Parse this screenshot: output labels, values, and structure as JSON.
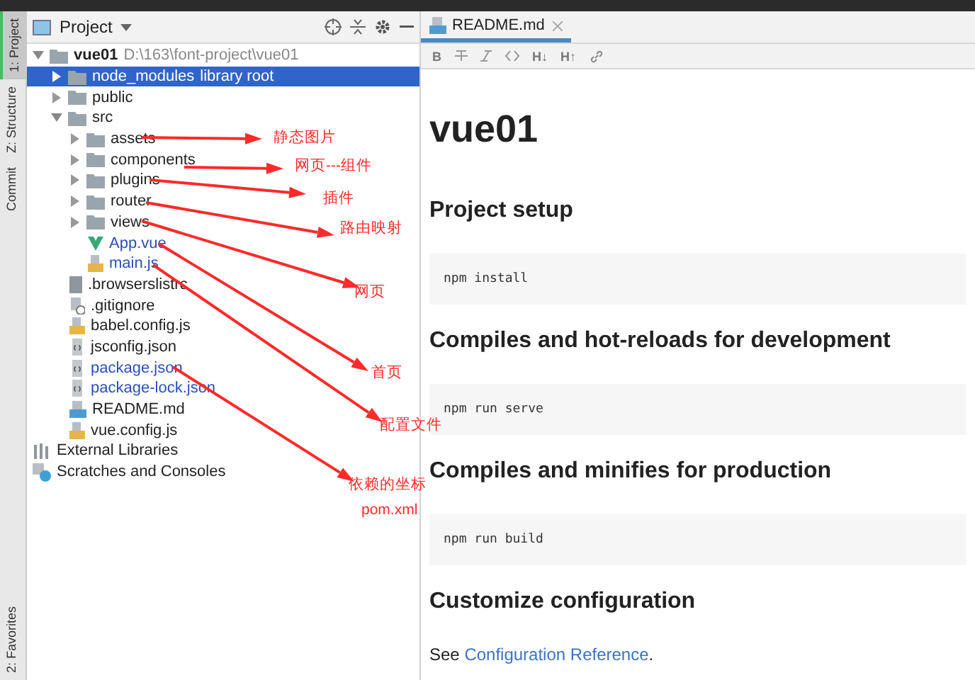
{
  "tool_strip": {
    "top": [
      {
        "label": "1: Project",
        "selected": true
      },
      {
        "label": "Z: Structure",
        "selected": false
      },
      {
        "label": "Commit",
        "selected": false
      }
    ],
    "bottom": [
      {
        "label": "2: Favorites",
        "selected": false
      }
    ]
  },
  "project_panel": {
    "title": "Project",
    "tree": [
      {
        "kind": "folder",
        "name": "vue01",
        "note": "D:\\163\\font-project\\vue01",
        "expanded": true,
        "selected": false,
        "children": [
          {
            "kind": "folder",
            "name": "node_modules",
            "note": "library root",
            "expanded": false,
            "selected": true
          },
          {
            "kind": "folder",
            "name": "public",
            "expanded": false,
            "selected": false
          },
          {
            "kind": "folder",
            "name": "src",
            "expanded": true,
            "selected": false,
            "children": [
              {
                "kind": "folder",
                "name": "assets",
                "expanded": false,
                "selected": false
              },
              {
                "kind": "folder",
                "name": "components",
                "expanded": false,
                "selected": false
              },
              {
                "kind": "folder",
                "name": "plugins",
                "expanded": false,
                "selected": false
              },
              {
                "kind": "folder",
                "name": "router",
                "expanded": false,
                "selected": false
              },
              {
                "kind": "folder",
                "name": "views",
                "expanded": false,
                "selected": false
              },
              {
                "kind": "vue",
                "name": "App.vue",
                "color": "#2a4fb8",
                "selected": false
              },
              {
                "kind": "js",
                "name": "main.js",
                "color": "#2a4fb8",
                "selected": false
              }
            ]
          },
          {
            "kind": "file",
            "name": ".browserslistrc",
            "color": "#222222",
            "selected": false
          },
          {
            "kind": "ignore",
            "name": ".gitignore",
            "color": "#222222",
            "selected": false
          },
          {
            "kind": "js",
            "name": "babel.config.js",
            "color": "#222222",
            "selected": false
          },
          {
            "kind": "json",
            "name": "jsconfig.json",
            "color": "#222222",
            "selected": false
          },
          {
            "kind": "json",
            "name": "package.json",
            "color": "#2a4fb8",
            "selected": false
          },
          {
            "kind": "json",
            "name": "package-lock.json",
            "color": "#2a4fb8",
            "selected": false
          },
          {
            "kind": "md",
            "name": "README.md",
            "color": "#222222",
            "selected": false
          },
          {
            "kind": "js",
            "name": "vue.config.js",
            "color": "#222222",
            "selected": false
          }
        ]
      },
      {
        "kind": "libraries",
        "name": "External Libraries",
        "color": "#222222",
        "selected": false
      },
      {
        "kind": "scratches",
        "name": "Scratches and Consoles",
        "color": "#222222",
        "selected": false
      }
    ]
  },
  "editor": {
    "tabs": [
      {
        "label": "README.md",
        "selected": true
      }
    ],
    "toolbar": [
      {
        "kind": "text",
        "label": "B"
      },
      {
        "kind": "strike"
      },
      {
        "kind": "italic"
      },
      {
        "kind": "code"
      },
      {
        "kind": "text",
        "label": "H↓"
      },
      {
        "kind": "text",
        "label": "H↑"
      },
      {
        "kind": "link"
      }
    ],
    "content": [
      {
        "kind": "h1",
        "text": "vue01"
      },
      {
        "kind": "h2",
        "text": "Project setup"
      },
      {
        "kind": "code",
        "text": "npm install"
      },
      {
        "kind": "h2",
        "text": "Compiles and hot-reloads for development"
      },
      {
        "kind": "code",
        "text": "npm run serve"
      },
      {
        "kind": "h2",
        "text": "Compiles and minifies for production"
      },
      {
        "kind": "code",
        "text": "npm run build"
      },
      {
        "kind": "h2",
        "text": "Customize configuration"
      },
      {
        "kind": "para",
        "text": "See ",
        "link": "Configuration Reference",
        "after": "."
      }
    ]
  },
  "annotations": [
    {
      "text": "静态图片"
    },
    {
      "text": "网页---组件"
    },
    {
      "text": "插件"
    },
    {
      "text": "路由映射"
    },
    {
      "text": "网页"
    },
    {
      "text": "首页"
    },
    {
      "text": "配置文件"
    },
    {
      "text": "依赖的坐标"
    },
    {
      "text": "pom.xml"
    }
  ]
}
